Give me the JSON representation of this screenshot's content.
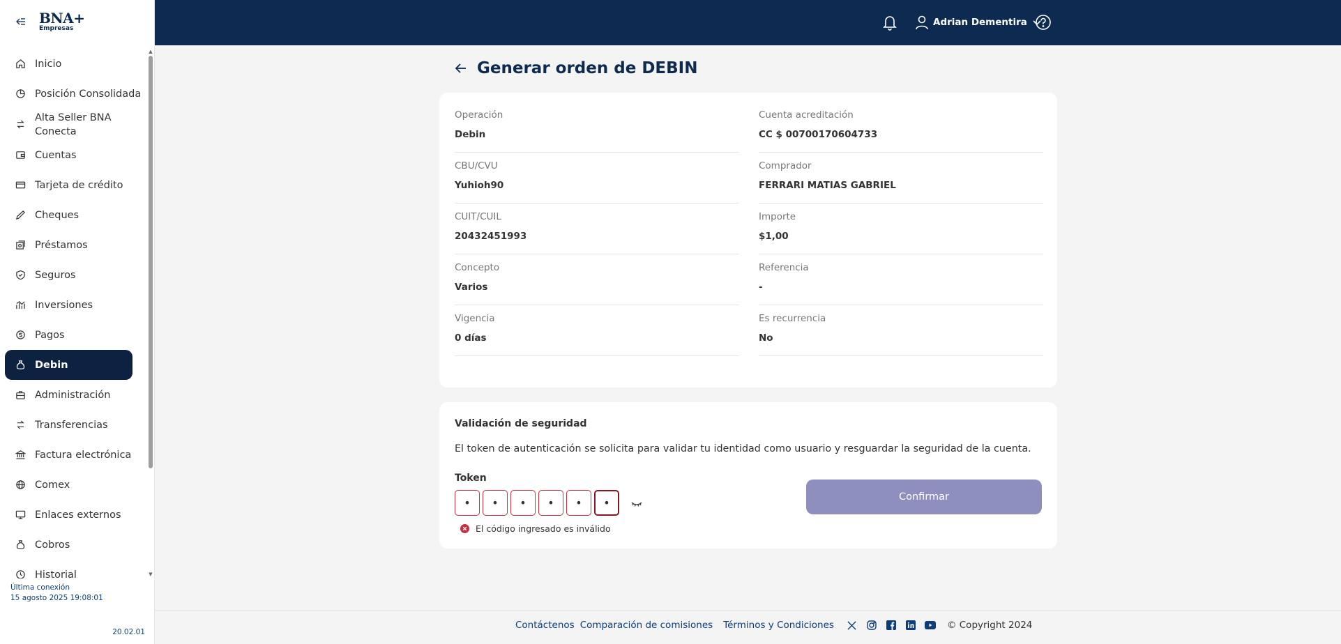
{
  "brand": {
    "logo": "BNA+",
    "sub": "Empresas"
  },
  "sidebar": {
    "items": [
      {
        "label": "Inicio",
        "icon": "home-icon"
      },
      {
        "label": "Posición Consolidada",
        "icon": "pie-chart-icon"
      },
      {
        "label": "Alta Seller BNA Conecta",
        "icon": "transfer-icon"
      },
      {
        "label": "Cuentas",
        "icon": "wallet-icon"
      },
      {
        "label": "Tarjeta de crédito",
        "icon": "credit-card-icon"
      },
      {
        "label": "Cheques",
        "icon": "pen-icon"
      },
      {
        "label": "Préstamos",
        "icon": "loan-icon"
      },
      {
        "label": "Seguros",
        "icon": "shield-icon"
      },
      {
        "label": "Inversiones",
        "icon": "investments-icon"
      },
      {
        "label": "Pagos",
        "icon": "coin-icon"
      },
      {
        "label": "Debin",
        "icon": "money-bag-icon",
        "active": true
      },
      {
        "label": "Administración",
        "icon": "briefcase-icon"
      },
      {
        "label": "Transferencias",
        "icon": "transfer-icon"
      },
      {
        "label": "Factura electrónica",
        "icon": "bank-icon"
      },
      {
        "label": "Comex",
        "icon": "globe-icon"
      },
      {
        "label": "Enlaces externos",
        "icon": "monitor-icon"
      },
      {
        "label": "Cobros",
        "icon": "money-bag-icon"
      },
      {
        "label": "Historial",
        "icon": "clock-icon"
      }
    ],
    "last_connection_label": "Última conexión",
    "last_connection_date": "15 agosto 2025 19:08:01",
    "version": "20.02.01"
  },
  "topbar": {
    "user_name": "Adrian Dementira"
  },
  "page": {
    "title": "Generar orden de DEBIN",
    "fields": [
      {
        "label": "Operación",
        "value": "Debin"
      },
      {
        "label": "Cuenta acreditación",
        "value": "CC $ 00700170604733"
      },
      {
        "label": "CBU/CVU",
        "value": "Yuhioh90"
      },
      {
        "label": "Comprador",
        "value": "FERRARI MATIAS GABRIEL"
      },
      {
        "label": "CUIT/CUIL",
        "value": "20432451993"
      },
      {
        "label": "Importe",
        "value": "$1,00"
      },
      {
        "label": "Concepto",
        "value": "Varios"
      },
      {
        "label": "Referencia",
        "value": "-"
      },
      {
        "label": "Vigencia",
        "value": "0 días"
      },
      {
        "label": "Es recurrencia",
        "value": "No"
      }
    ]
  },
  "security": {
    "title": "Validación de seguridad",
    "description": "El token de autenticación se solicita para validar tu identidad como usuario y resguardar la seguridad de la cuenta.",
    "token_label": "Token",
    "token_digits": [
      "•",
      "•",
      "•",
      "•",
      "•",
      "•"
    ],
    "error": "El código ingresado es inválido",
    "confirm_label": "Confirmar"
  },
  "footer": {
    "contact": "Contáctenos",
    "fees": "Comparación de comisiones",
    "terms": "Términos y Condiciones",
    "copyright": "© Copyright 2024",
    "social": [
      "x-icon",
      "instagram-icon",
      "facebook-icon",
      "linkedin-icon",
      "youtube-icon"
    ]
  },
  "colors": {
    "navy": "#0d2a50",
    "active": "#0d2240",
    "confirm_disabled": "#8e8ebf",
    "error": "#c9303e",
    "link": "#0a3d7a"
  }
}
